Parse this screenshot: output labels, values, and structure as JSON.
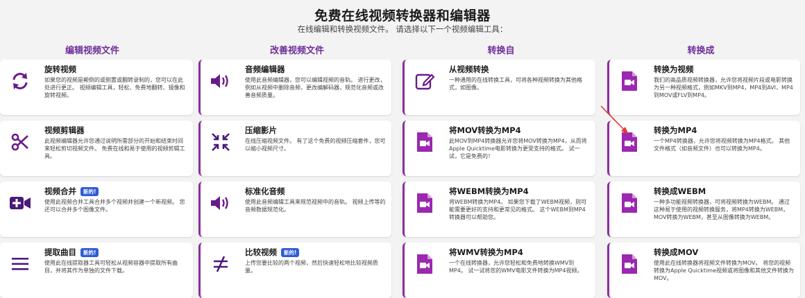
{
  "header": {
    "title": "免费在线视频转换器和编辑器",
    "subtitle": "在线编辑和转换视频文件。 请选择以下一个视频编辑工具："
  },
  "columns": [
    {
      "heading": "编辑视频文件",
      "cards": [
        {
          "title": "旋转视频",
          "badge": "",
          "icon": "rotate-icon",
          "desc": "如果您的视频是颠倒的或侧置或翻转录制的，您可以在此处进行更正。 视频编辑工具，轻松、免费地翻转、镜像和旋转视频。"
        },
        {
          "title": "视频剪辑器",
          "badge": "",
          "icon": "scissors-icon",
          "desc": "此视频编辑器允许您通过说明所需部分的开始和结束时间来轻松剪切视频文件。 免费在线和易于使用的视频剪辑工具。"
        },
        {
          "title": "视频合并",
          "badge": "新的!",
          "icon": "video-plus-icon",
          "desc": "使用此视频合并工具合并多个视频并创建一个新视频。 您还可以合并多个图像文件。"
        },
        {
          "title": "提取曲目",
          "badge": "新的!",
          "icon": "list-icon",
          "desc": "使用此在线提取器工具可轻松从视频容器中提取所有曲目，并将其作为单独的文件下载。"
        }
      ]
    },
    {
      "heading": "改善视频文件",
      "cards": [
        {
          "title": "音频编辑器",
          "badge": "",
          "icon": "speaker-icon",
          "desc": "使用此音频编辑器，您可以编辑视频的音轨。 进行更改，例如从视频中删除音频，更改编解码器，规范化音频或改善音频质量。"
        },
        {
          "title": "压缩影片",
          "badge": "",
          "icon": "compress-icon",
          "desc": "在线压缩视频文件。 有了这个免费的视频压缩套件，您可以缩小视频尺寸。"
        },
        {
          "title": "标准化音频",
          "badge": "",
          "icon": "speaker-icon",
          "desc": "使用此音频编辑工具来规范视频中的音轨。 视频上传等的音频数据规范化。"
        },
        {
          "title": "比较视频",
          "badge": "新的!",
          "icon": "not-equal-icon",
          "desc": "上传您要比较的两个视频，然后快速轻松地比较视频质量。"
        }
      ]
    },
    {
      "heading": "转换自",
      "cards": [
        {
          "title": "从视频转换",
          "badge": "",
          "icon": "edit-icon",
          "desc": "一种通用的在线转换工具，可将各种视频转换为其他格式，如图像。"
        },
        {
          "title": "将MOV转换为MP4",
          "badge": "",
          "icon": "video-file-icon",
          "desc": "此MOV到MP4转换器允许您将MOV转换为MP4，从而将Apple Quicktime电影转换为更受支持的格式。 试一试，它是免费的！"
        },
        {
          "title": "将WEBM转换为MP4",
          "badge": "",
          "icon": "video-file-icon",
          "desc": "将WEBM转换为MP4。 如果您下载了WEBM视频，则可能需要更好的支持和更常见的格式。 这个WEBM到MP4转换器可以帮助您。"
        },
        {
          "title": "将WMV转换为MP4",
          "badge": "",
          "icon": "video-file-icon",
          "desc": "一个在线转换器，允许您轻松和免费地转换WMV到MP4。 试一试将您的WMV电影文件转换为MP4视频。"
        }
      ]
    },
    {
      "heading": "转换成",
      "cards": [
        {
          "title": "转换为视频",
          "badge": "",
          "icon": "video-file-icon",
          "desc": "我们的高品质视频转换器，允许您将视频片段或电影转换为另一种视频格式，例如MKV到MP4，MP4到AVI，MP4到MOV或FLV到MP4。"
        },
        {
          "title": "转换为MP4",
          "badge": "",
          "icon": "video-file-icon",
          "desc": "一个MP4转换器，允许您将视频转换为MP4格式。 其他文件格式（如音频文件）也可以转换为MP4。"
        },
        {
          "title": "转换成WEBM",
          "badge": "",
          "icon": "video-file-icon",
          "desc": "一种多功能视频转换器，可将视频转换为WEBM。 通过这种易于使用的视频转换服务，将MP4转换为WEBM，MOV转换为WEBM，甚至从图像转换为WEBM。"
        },
        {
          "title": "转换成MOV",
          "badge": "",
          "icon": "video-file-icon",
          "desc": "使用此在线转换器将视频文件转换为MOV。 将您的视频转换为Apple Quicktime视频或将图像和其他文件转换为MOV。"
        }
      ]
    }
  ],
  "colors": {
    "accent": "#8b2f9e",
    "heading": "#6f2e9b",
    "badge": "#2f5bd6",
    "annotation": "#e53935"
  }
}
